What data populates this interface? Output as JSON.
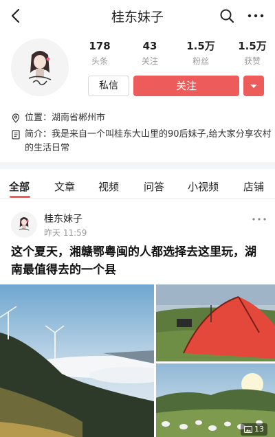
{
  "nav": {
    "title": "桂东妹子",
    "back_icon": "back-arrow-icon",
    "search_icon": "search-icon",
    "more_icon": "more-icon"
  },
  "profile": {
    "stats": [
      {
        "value": "178",
        "label": "头条"
      },
      {
        "value": "43",
        "label": "关注"
      },
      {
        "value": "1.5万",
        "label": "粉丝"
      },
      {
        "value": "1.5万",
        "label": "获赞"
      }
    ],
    "message_button": "私信",
    "follow_button": "关注",
    "location": "位置：湖南省郴州市",
    "bio": "简介：我是来自一个叫桂东大山里的90后妹子,给大家分享农村的生活日常"
  },
  "tabs": [
    "全部",
    "文章",
    "视频",
    "问答",
    "小视频",
    "店铺"
  ],
  "active_tab": "全部",
  "post": {
    "author": "桂东妹子",
    "time": "昨天 11:59",
    "title": "这个夏天，湘赣鄂粤闽的人都选择去这里玩，湖南最值得去的一个县",
    "image_count": "13"
  },
  "colors": {
    "accent": "#ee5b5b",
    "divider": "#f4f5f6",
    "muted_text": "#999999"
  }
}
